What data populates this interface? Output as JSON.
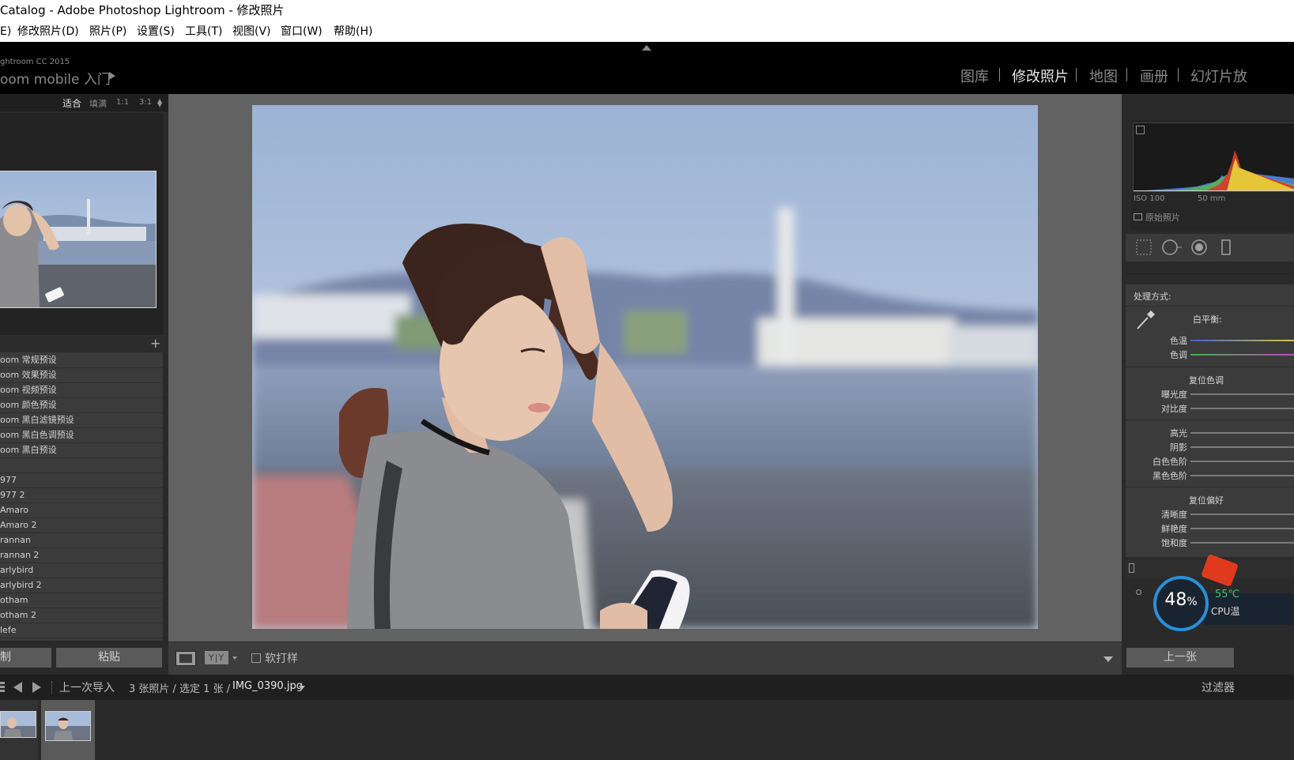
{
  "window": {
    "title": "Catalog - Adobe Photoshop Lightroom - 修改照片"
  },
  "menu": [
    {
      "label": "E)"
    },
    {
      "label": "修改照片(D)"
    },
    {
      "label": "照片(P)"
    },
    {
      "label": "设置(S)"
    },
    {
      "label": "工具(T)"
    },
    {
      "label": "视图(V)"
    },
    {
      "label": "窗口(W)"
    },
    {
      "label": "帮助(H)"
    }
  ],
  "identity": {
    "version": "ghtroom CC 2015",
    "mobile": "oom mobile 入门"
  },
  "modules": [
    {
      "label": "图库",
      "active": false
    },
    {
      "label": "修改照片",
      "active": true
    },
    {
      "label": "地图",
      "active": false
    },
    {
      "label": "画册",
      "active": false
    },
    {
      "label": "幻灯片放",
      "active": false
    }
  ],
  "navigator": {
    "options": [
      "适合",
      "填满",
      "1:1",
      "3:1"
    ],
    "active": "适合"
  },
  "presets": [
    "oom 常规预设",
    "oom 效果预设",
    "oom 视频预设",
    "oom 颜色预设",
    "oom 黑白滤镜预设",
    "oom 黑白色调预设",
    "oom 黑白预设",
    "",
    "977",
    "977 2",
    "Amaro",
    "Amaro 2",
    "rannan",
    "rannan 2",
    "arlybird",
    "arlybird 2",
    "otham",
    "otham 2",
    "lefe"
  ],
  "left_buttons": {
    "copy": "制",
    "paste": "粘贴"
  },
  "toolbar": {
    "yy": "Y|Y",
    "softproof": "软打样"
  },
  "right": {
    "iso": "ISO 100",
    "focal": "50 mm",
    "original": "原始照片",
    "treatment": "处理方式:",
    "wb": "白平衡:",
    "temp": "色温",
    "tint": "色调",
    "tone_head": "复位色调",
    "exposure": "曝光度",
    "contrast": "对比度",
    "highlights": "高光",
    "shadows": "阴影",
    "whites": "白色色阶",
    "blacks": "黑色色阶",
    "presence_head": "复位偏好",
    "clarity": "清晰度",
    "vibrance": "鲜艳度",
    "saturation": "饱和度",
    "prev": "上一张"
  },
  "monitor": {
    "cpu_percent": "48",
    "pct_sign": "%",
    "temp": "55℃",
    "label": "CPU温"
  },
  "filmbar": {
    "source": "上一次导入",
    "count": "3 张照片 / 选定 1 张 /",
    "filename": "IMG_0390.jpg",
    "filter": "过滤器"
  },
  "colors": {
    "accent_blue": "#2b8fd8",
    "temp_green": "#39c66a",
    "gift_red": "#e03a1e"
  }
}
